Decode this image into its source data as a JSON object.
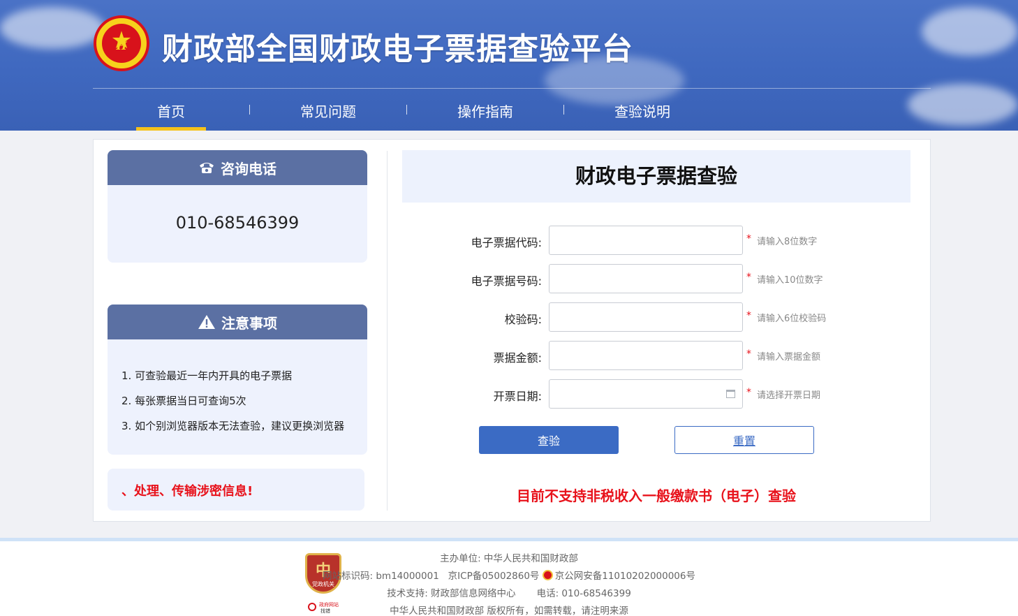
{
  "header": {
    "site_title": "财政部全国财政电子票据查验平台",
    "logo_letter": "H",
    "nav": [
      {
        "label": "首页",
        "active": true
      },
      {
        "label": "常见问题",
        "active": false
      },
      {
        "label": "操作指南",
        "active": false
      },
      {
        "label": "查验说明",
        "active": false
      }
    ]
  },
  "left": {
    "consult": {
      "title": "咨询电话",
      "icon": "phone-icon",
      "phone": "010-68546399"
    },
    "notice": {
      "title": "注意事项",
      "icon": "warning-icon",
      "items": [
        "1. 可查验最近一年内开具的电子票据",
        "2. 每张票据当日可查询5次",
        "3. 如个别浏览器版本无法查验，建议更换浏览器"
      ]
    },
    "warning_text": "、处理、传输涉密信息!"
  },
  "form": {
    "title": "财政电子票据查验",
    "fields": [
      {
        "label": "电子票据代码:",
        "value": "",
        "hint": "请输入8位数字"
      },
      {
        "label": "电子票据号码:",
        "value": "",
        "hint": "请输入10位数字"
      },
      {
        "label": "校验码:",
        "value": "",
        "hint": "请输入6位校验码"
      },
      {
        "label": "票据金额:",
        "value": "",
        "hint": "请输入票据金额"
      },
      {
        "label": "开票日期:",
        "value": "",
        "hint": "请选择开票日期"
      }
    ],
    "required_mark": "*",
    "submit_label": "查验",
    "reset_label": "重置",
    "notice": "目前不支持非税收入一般缴款书（电子）查验"
  },
  "footer": {
    "sponsor": "主办单位: 中华人民共和国财政部",
    "site_id": "网站标识码: bm14000001",
    "icp": "京ICP备05002860号",
    "police": "京公网安备11010202000006号",
    "tech_support": "技术支持: 财政部信息网络中心",
    "phone": "电话: 010-68546399",
    "copyright": "中华人民共和国财政部 版权所有，如需转载，请注明来源",
    "badge_text": "党政机关",
    "badge_emblem": "中",
    "small_logo_top": "政府网站",
    "small_logo_bottom": "找错"
  },
  "colors": {
    "header_blue": "#4a72c6",
    "card_header": "#5b70a3",
    "accent_yellow": "#f5c21b",
    "button_blue": "#3b6bc4",
    "alert_red": "#e8121b"
  }
}
